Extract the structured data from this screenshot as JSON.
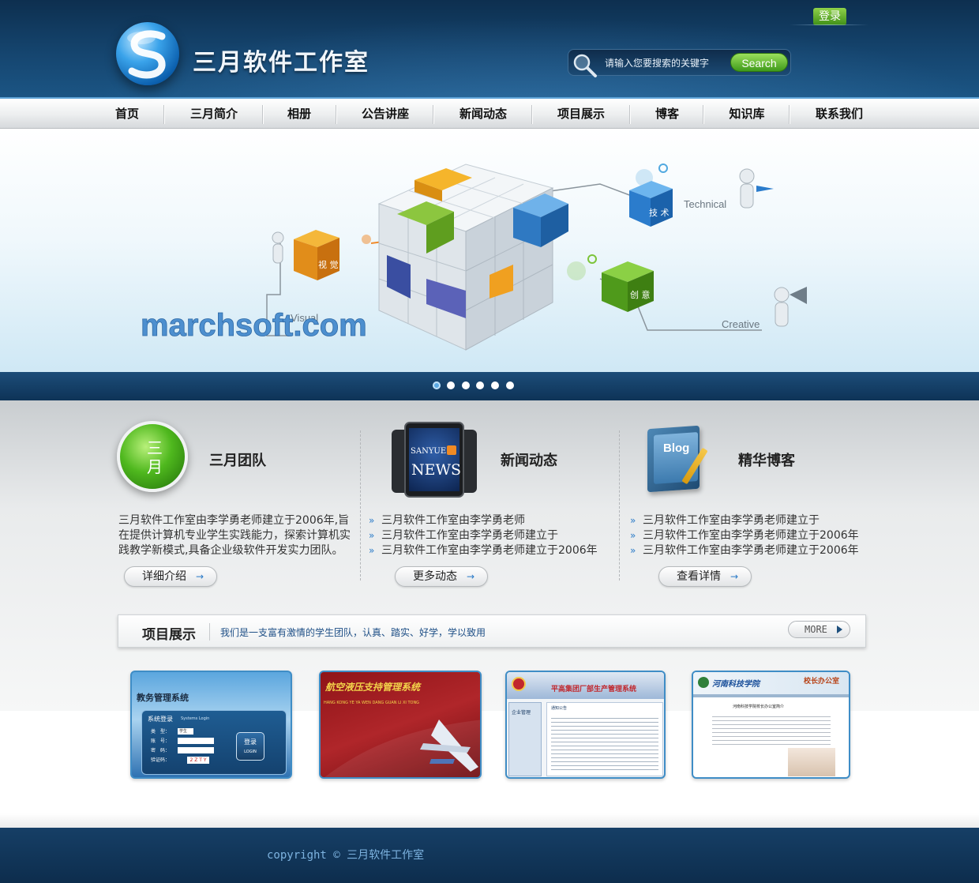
{
  "header": {
    "title": "三月软件工作室",
    "login_label": "登录",
    "search_placeholder": "请输入您要搜索的关键字",
    "search_label": "Search"
  },
  "nav": {
    "items": [
      {
        "label": "首页"
      },
      {
        "label": "三月简介"
      },
      {
        "label": "相册"
      },
      {
        "label": "公告讲座"
      },
      {
        "label": "新闻动态"
      },
      {
        "label": "项目展示"
      },
      {
        "label": "博客"
      },
      {
        "label": "知识库"
      },
      {
        "label": "联系我们"
      }
    ]
  },
  "banner": {
    "brand": "marchsoft.com",
    "labels": {
      "technical": "Technical",
      "visual": "Visual",
      "creative": "Creative"
    },
    "cube_texts": {
      "visual": "视 觉",
      "technical": "技 术",
      "creative": "创 意"
    },
    "slides": 6,
    "active_slide": 1
  },
  "sections": {
    "team": {
      "title": "三月团队",
      "icon_text": "三月",
      "description": "三月软件工作室由李学勇老师建立于2006年,旨在提供计算机专业学生实践能力，探索计算机实践教学新模式,具备企业级软件开发实力团队。",
      "button": "详细介绍"
    },
    "news": {
      "title": "新闻动态",
      "tablet_brand": "SANYUE",
      "tablet_text": "NEWS",
      "items": [
        "三月软件工作室由李学勇老师",
        "三月软件工作室由李学勇老师建立于",
        "三月软件工作室由李学勇老师建立于2006年"
      ],
      "button": "更多动态"
    },
    "blog": {
      "title": "精华博客",
      "book_text": "Blog",
      "items": [
        "三月软件工作室由李学勇老师建立于",
        "三月软件工作室由李学勇老师建立于2006年",
        "三月软件工作室由李学勇老师建立于2006年"
      ],
      "button": "查看详情"
    }
  },
  "projects": {
    "title": "项目展示",
    "slogan": "我们是一支富有激情的学生团队，认真、踏实、好学，学以致用",
    "more_label": "MORE",
    "thumbs": [
      {
        "title": "教务管理系统",
        "panel_label": "系统登录",
        "panel_sub": "Systems Login",
        "fields": [
          "类　型：",
          "账　号：",
          "密　码：",
          "验证码："
        ],
        "type_value": "学生",
        "captcha": "2 Z T Y",
        "login_btn": "登录",
        "login_btn_en": "LOGIN"
      },
      {
        "title": "航空液压支持管理系统",
        "subtitle": "HANG KONG YE YA WEN DANG GUAN LI XI TONG"
      },
      {
        "title": "平高集团厂部生产管理系统",
        "side_label": "企业管理",
        "notice_label": "通知公告"
      },
      {
        "title": "河南科技学院",
        "right_title": "校长办公室",
        "heading": "河南科技学院校长办公室简介"
      }
    ]
  },
  "footer": {
    "prefix": "copyright © ",
    "name": "三月软件工作室"
  }
}
